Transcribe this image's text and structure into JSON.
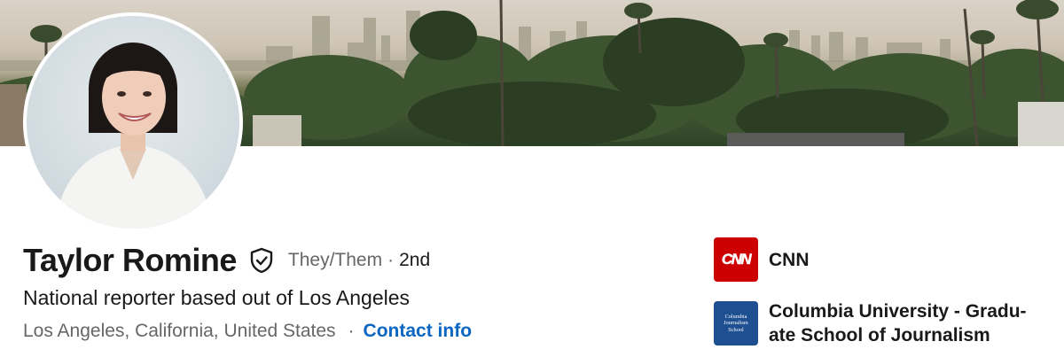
{
  "profile": {
    "name": "Taylor Romine",
    "verified_icon": "shield-check-icon",
    "pronouns": "They/Them",
    "separator": "·",
    "connection_degree": "2nd",
    "headline": "National reporter based out of Los Angeles",
    "location": "Los Angeles, California, United States",
    "location_separator": "·",
    "contact_label": "Contact info"
  },
  "organizations": [
    {
      "name": "CNN",
      "logo_text": "CNN",
      "logo_color": "#cc0000"
    },
    {
      "name": "Columbia University - Gradu- ate School of Journalism",
      "logo_lines": [
        "Columbia",
        "Journalism",
        "School"
      ],
      "logo_color": "#1d4f91"
    }
  ],
  "colors": {
    "link": "#0a66c2",
    "secondary_text": "#666666",
    "primary_text": "#191919"
  }
}
